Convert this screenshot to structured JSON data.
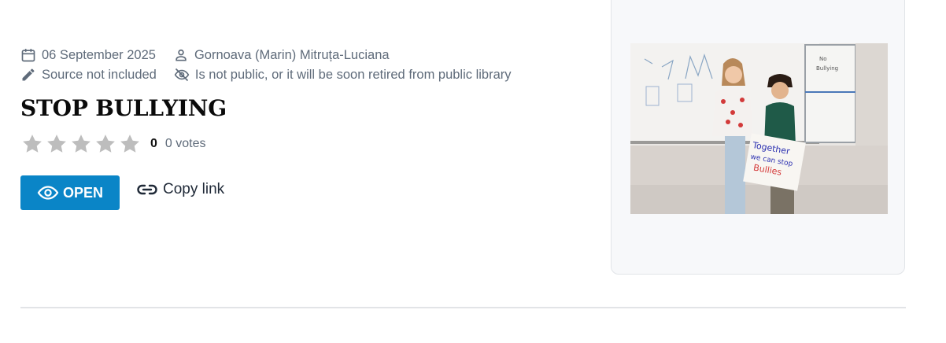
{
  "meta": {
    "date": "06 September 2025",
    "author": "Gornoava (Marin) Mitruța-Luciana",
    "source": "Source not included",
    "visibility": "Is not public, or it will be soon retired from public library"
  },
  "title": "STOP BULLYING",
  "rating": {
    "value": 0,
    "max_stars": 5,
    "score_label": "0",
    "votes_label": "0 votes"
  },
  "actions": {
    "open_label": "OPEN",
    "copy_label": "Copy link"
  },
  "thumbnail": {
    "sign_lines": [
      "Together",
      "we can stop",
      "Bullies"
    ],
    "whiteboard_note": "No Bullying"
  },
  "colors": {
    "primary": "#0a85c7",
    "meta_text": "#5f6b7a",
    "star_empty": "#bdbdbd"
  }
}
